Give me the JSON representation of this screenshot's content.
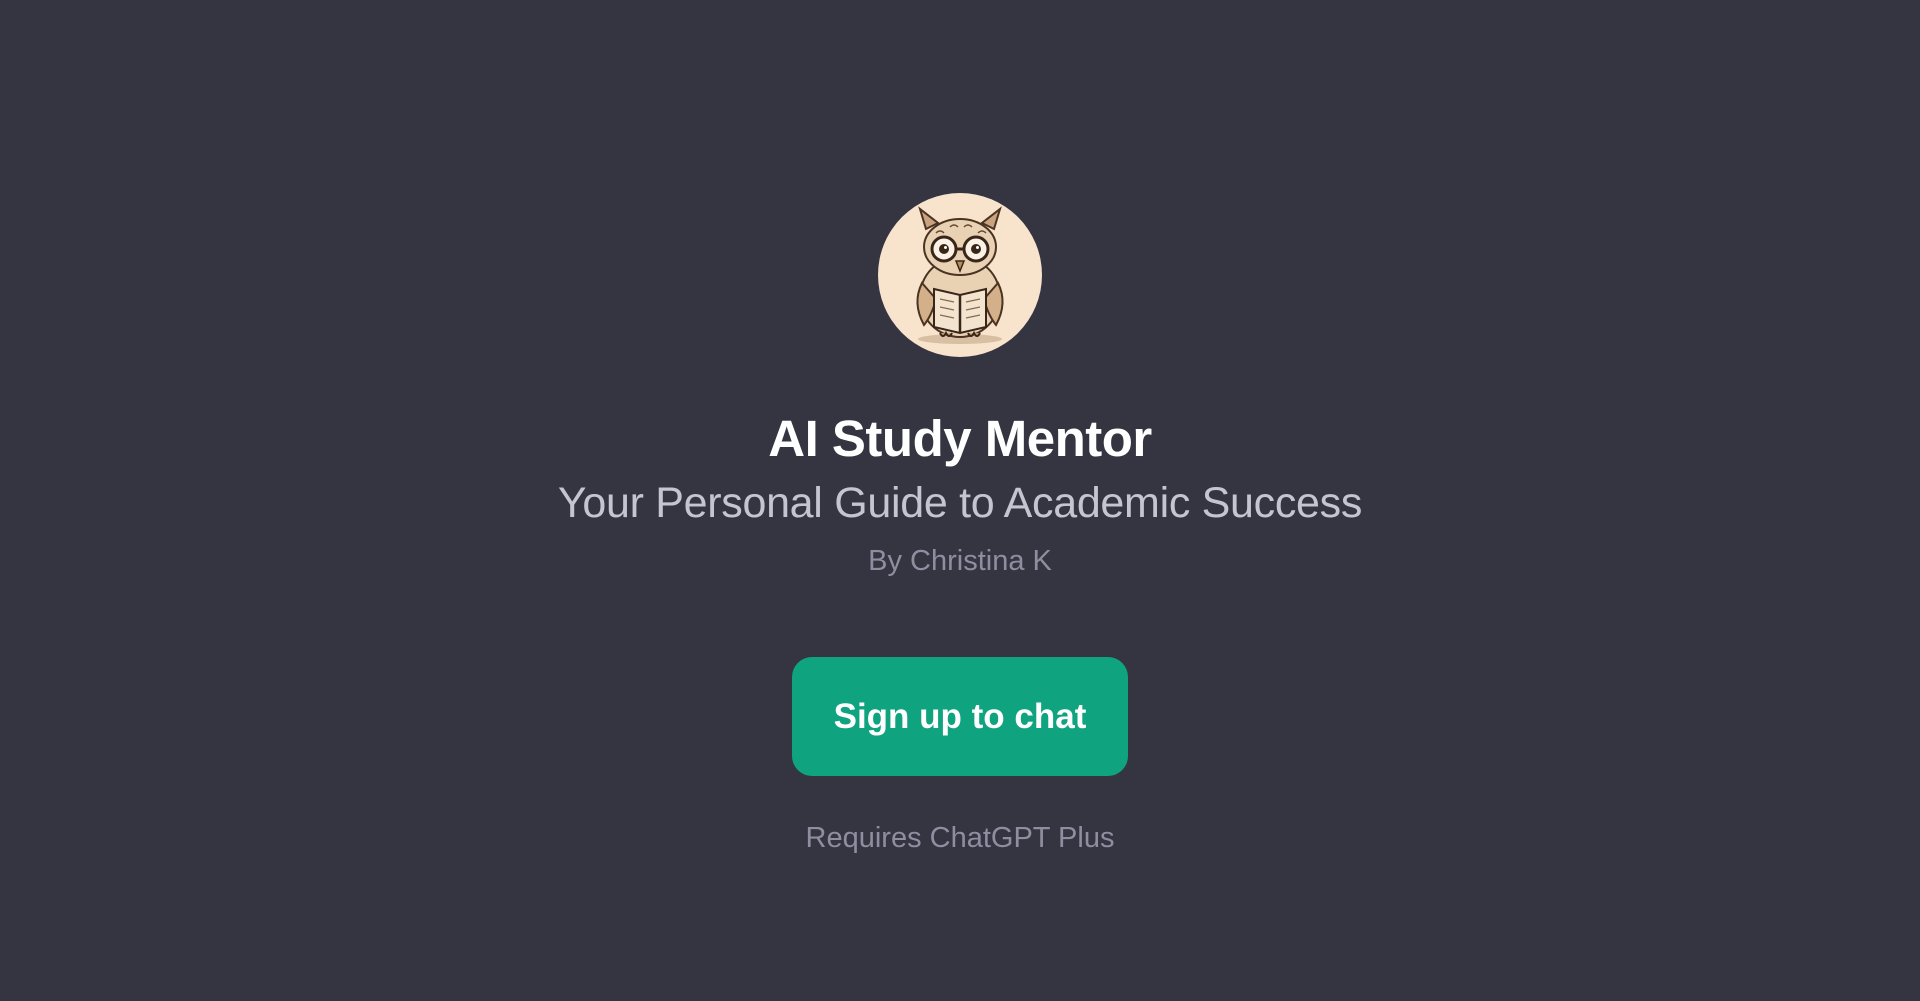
{
  "gpt": {
    "avatar_icon": "owl-reading-book-icon",
    "title": "AI Study Mentor",
    "subtitle": "Your Personal Guide to Academic Success",
    "author": "By Christina K"
  },
  "actions": {
    "signup_label": "Sign up to chat"
  },
  "footer": {
    "requirement": "Requires ChatGPT Plus"
  },
  "colors": {
    "background": "#343541",
    "accent": "#10a37f",
    "title": "#ffffff",
    "subtitle": "#c5c5d2",
    "muted": "#8e8ea0",
    "avatar_bg": "#f8e3cc"
  }
}
